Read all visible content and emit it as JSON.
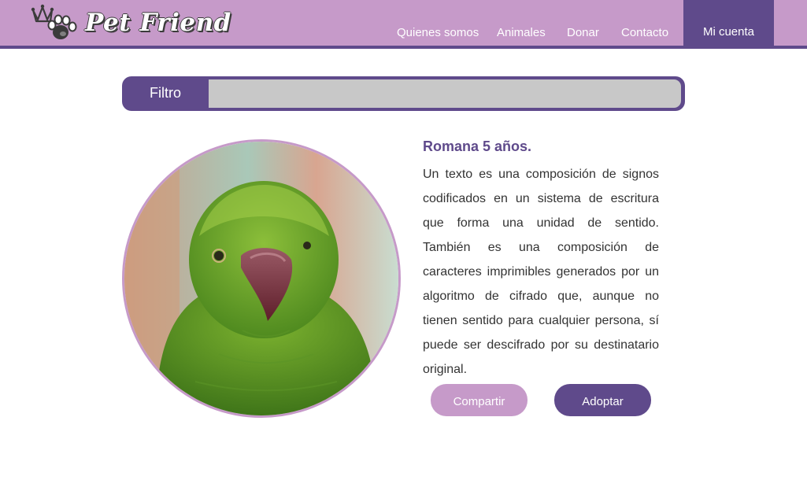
{
  "brand": {
    "name": "Pet Friend",
    "icon": "paw-crown-icon"
  },
  "nav": {
    "items": [
      {
        "label": "Quienes somos"
      },
      {
        "label": "Animales"
      },
      {
        "label": "Donar"
      },
      {
        "label": "Contacto"
      }
    ],
    "account_label": "Mi cuenta"
  },
  "filter": {
    "label": "Filtro",
    "value": "",
    "placeholder": ""
  },
  "pet": {
    "photo_alt": "Perico verde",
    "title": "Romana 5 años.",
    "description": "Un texto es una composición de signos codificados en un sistema de escritura que forma una unidad de sentido. También es una composición de caracteres imprimibles generados por un algoritmo de cifrado que, aunque no tienen sentido para cualquier persona, sí puede ser descifrado por su destinatario original."
  },
  "actions": {
    "share_label": "Compartir",
    "adopt_label": "Adoptar"
  },
  "colors": {
    "primary": "#5f4a8b",
    "accent": "#c69ac9",
    "input_bg": "#c8c8c8"
  }
}
